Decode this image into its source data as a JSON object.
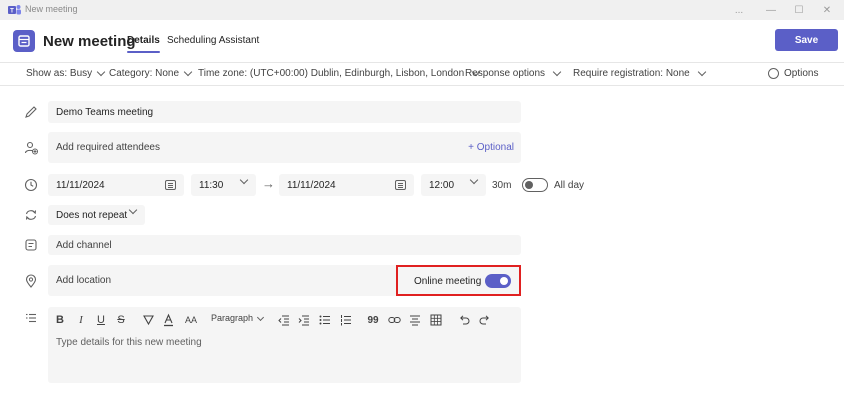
{
  "window": {
    "title": "New meeting",
    "controls": [
      "...",
      "—",
      "☐",
      "✕"
    ]
  },
  "header": {
    "title": "New meeting",
    "tabs": [
      {
        "label": "Details",
        "active": true
      },
      {
        "label": "Scheduling Assistant",
        "active": false
      }
    ],
    "save_label": "Save",
    "accent_color": "#5b5fc7"
  },
  "options_bar": {
    "show_as": "Show as: Busy",
    "category": "Category: None",
    "time_zone": "Time zone: (UTC+00:00) Dublin, Edinburgh, Lisbon, London",
    "response_options": "Response options",
    "require_registration": "Require registration: None",
    "options": "Options"
  },
  "form": {
    "title_value": "Demo Teams meeting",
    "attendees_placeholder": "Add required attendees",
    "optional_label": "+ Optional",
    "start_date": "11/11/2024",
    "start_time": "11:30",
    "end_date": "11/11/2024",
    "end_time": "12:00",
    "duration": "30m",
    "all_day_label": "All day",
    "all_day_on": false,
    "repeat_value": "Does not repeat",
    "channel_placeholder": "Add channel",
    "location_placeholder": "Add location",
    "online_meeting_label": "Online meeting",
    "online_meeting_on": true,
    "highlight_color": "#e02020"
  },
  "editor": {
    "toolbar": {
      "bold": "B",
      "italic": "I",
      "underline": "U",
      "strike": "S",
      "paragraph": "Paragraph",
      "font_size": "AA",
      "quote": "99"
    },
    "placeholder": "Type details for this new meeting"
  }
}
